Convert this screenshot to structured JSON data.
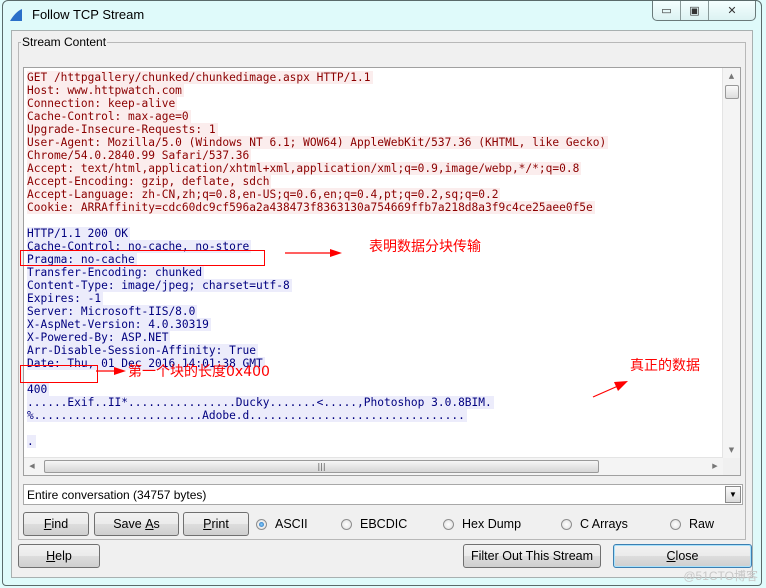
{
  "window": {
    "title": "Follow TCP Stream",
    "controls": {
      "minimize": "▭",
      "maximize": "▣",
      "close": "✕"
    }
  },
  "group": {
    "legend": "Stream Content"
  },
  "stream": {
    "lines": [
      {
        "dir": "client",
        "text": "GET /httpgallery/chunked/chunkedimage.aspx HTTP/1.1"
      },
      {
        "dir": "client",
        "text": "Host: www.httpwatch.com"
      },
      {
        "dir": "client",
        "text": "Connection: keep-alive"
      },
      {
        "dir": "client",
        "text": "Cache-Control: max-age=0"
      },
      {
        "dir": "client",
        "text": "Upgrade-Insecure-Requests: 1"
      },
      {
        "dir": "client",
        "text": "User-Agent: Mozilla/5.0 (Windows NT 6.1; WOW64) AppleWebKit/537.36 (KHTML, like Gecko)"
      },
      {
        "dir": "client",
        "text": "Chrome/54.0.2840.99 Safari/537.36"
      },
      {
        "dir": "client",
        "text": "Accept: text/html,application/xhtml+xml,application/xml;q=0.9,image/webp,*/*;q=0.8"
      },
      {
        "dir": "client",
        "text": "Accept-Encoding: gzip, deflate, sdch"
      },
      {
        "dir": "client",
        "text": "Accept-Language: zh-CN,zh;q=0.8,en-US;q=0.6,en;q=0.4,pt;q=0.2,sq;q=0.2"
      },
      {
        "dir": "client",
        "text": "Cookie: ARRAffinity=cdc60dc9cf596a2a438473f8363130a754669ffb7a218d8a3f9c4ce25aee0f5e"
      },
      {
        "dir": "blank",
        "text": ""
      },
      {
        "dir": "server",
        "text": "HTTP/1.1 200 OK"
      },
      {
        "dir": "server",
        "text": "Cache-Control: no-cache, no-store"
      },
      {
        "dir": "server",
        "text": "Pragma: no-cache"
      },
      {
        "dir": "server",
        "text": "Transfer-Encoding: chunked"
      },
      {
        "dir": "server",
        "text": "Content-Type: image/jpeg; charset=utf-8"
      },
      {
        "dir": "server",
        "text": "Expires: -1"
      },
      {
        "dir": "server",
        "text": "Server: Microsoft-IIS/8.0"
      },
      {
        "dir": "server",
        "text": "X-AspNet-Version: 4.0.30319"
      },
      {
        "dir": "server",
        "text": "X-Powered-By: ASP.NET"
      },
      {
        "dir": "server",
        "text": "Arr-Disable-Session-Affinity: True"
      },
      {
        "dir": "server",
        "text": "Date: Thu, 01 Dec 2016 14:01:38 GMT"
      },
      {
        "dir": "blank",
        "text": ""
      },
      {
        "dir": "server",
        "text": "400"
      },
      {
        "dir": "server",
        "text": "......Exif..II*................Ducky.......<.....,Photoshop 3.0.8BIM."
      },
      {
        "dir": "server",
        "text": "%.........................Adobe.d................................"
      },
      {
        "dir": "blank",
        "text": ""
      },
      {
        "dir": "server",
        "text": "."
      }
    ]
  },
  "annotations": {
    "chunked_note": "表明数据分块传输",
    "first_chunk_note": "第一个块的长度0x400",
    "real_data_note": "真正的数据",
    "color": "#ff0000"
  },
  "conversation_select": {
    "value": "Entire conversation (34757 bytes)"
  },
  "buttons": {
    "find": {
      "pre": "",
      "key": "F",
      "post": "ind"
    },
    "save_as": {
      "pre": "Save ",
      "key": "A",
      "post": "s"
    },
    "print": {
      "pre": "",
      "key": "P",
      "post": "rint"
    },
    "help": {
      "pre": "",
      "key": "H",
      "post": "elp"
    },
    "filter_out": {
      "label": "Filter Out This Stream"
    },
    "close": {
      "pre": "",
      "key": "C",
      "post": "lose"
    }
  },
  "format_options": {
    "selected": "ASCII",
    "items": [
      "ASCII",
      "EBCDIC",
      "Hex Dump",
      "C Arrays",
      "Raw"
    ]
  },
  "colors": {
    "client_text": "#8b0000",
    "client_bg": "#fbeded",
    "server_text": "#00007f",
    "server_bg": "#ececfb"
  },
  "watermark": "@51CTO博客"
}
